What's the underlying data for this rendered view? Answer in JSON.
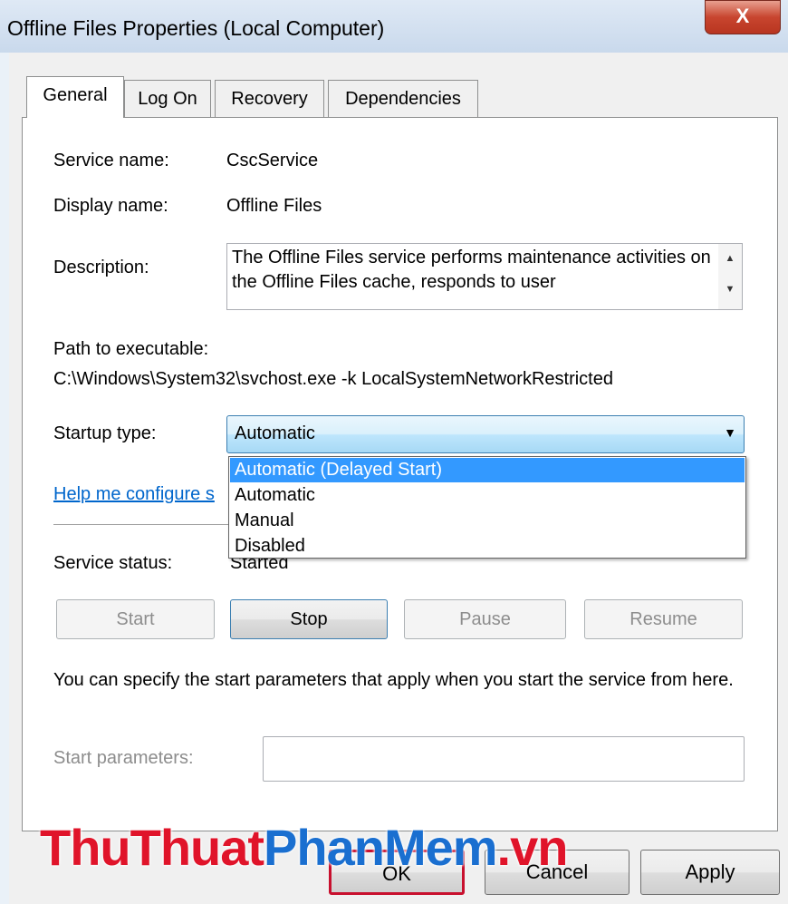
{
  "window": {
    "title": "Offline Files Properties (Local Computer)",
    "close_label": "X"
  },
  "tabs": [
    {
      "label": "General",
      "active": true
    },
    {
      "label": "Log On",
      "active": false
    },
    {
      "label": "Recovery",
      "active": false
    },
    {
      "label": "Dependencies",
      "active": false
    }
  ],
  "general": {
    "service_name_label": "Service name:",
    "service_name_value": "CscService",
    "display_name_label": "Display name:",
    "display_name_value": "Offline Files",
    "description_label": "Description:",
    "description_value": "The Offline Files service performs maintenance activities on the Offline Files cache, responds to user",
    "path_label": "Path to executable:",
    "path_value": "C:\\Windows\\System32\\svchost.exe -k LocalSystemNetworkRestricted",
    "startup_type_label": "Startup type:",
    "startup_type_value": "Automatic",
    "startup_options": [
      {
        "label": "Automatic (Delayed Start)",
        "highlighted": true
      },
      {
        "label": "Automatic",
        "highlighted": false
      },
      {
        "label": "Manual",
        "highlighted": false
      },
      {
        "label": "Disabled",
        "highlighted": false
      }
    ],
    "help_link": "Help me configure s",
    "service_status_label": "Service status:",
    "service_status_value": "Started",
    "buttons": {
      "start": "Start",
      "stop": "Stop",
      "pause": "Pause",
      "resume": "Resume"
    },
    "start_params_info": "You can specify the start parameters that apply when you start the service from here.",
    "start_params_label": "Start parameters:",
    "start_params_value": ""
  },
  "dialog_buttons": {
    "ok": "OK",
    "cancel": "Cancel",
    "apply": "Apply"
  },
  "watermark": {
    "part1": "ThuThuat",
    "part2": "PhanMem",
    "part3": ".vn"
  },
  "colors": {
    "selection": "#3399ff",
    "link": "#0066cc",
    "watermark_red": "#e0142a",
    "watermark_blue": "#1a6fd0"
  }
}
